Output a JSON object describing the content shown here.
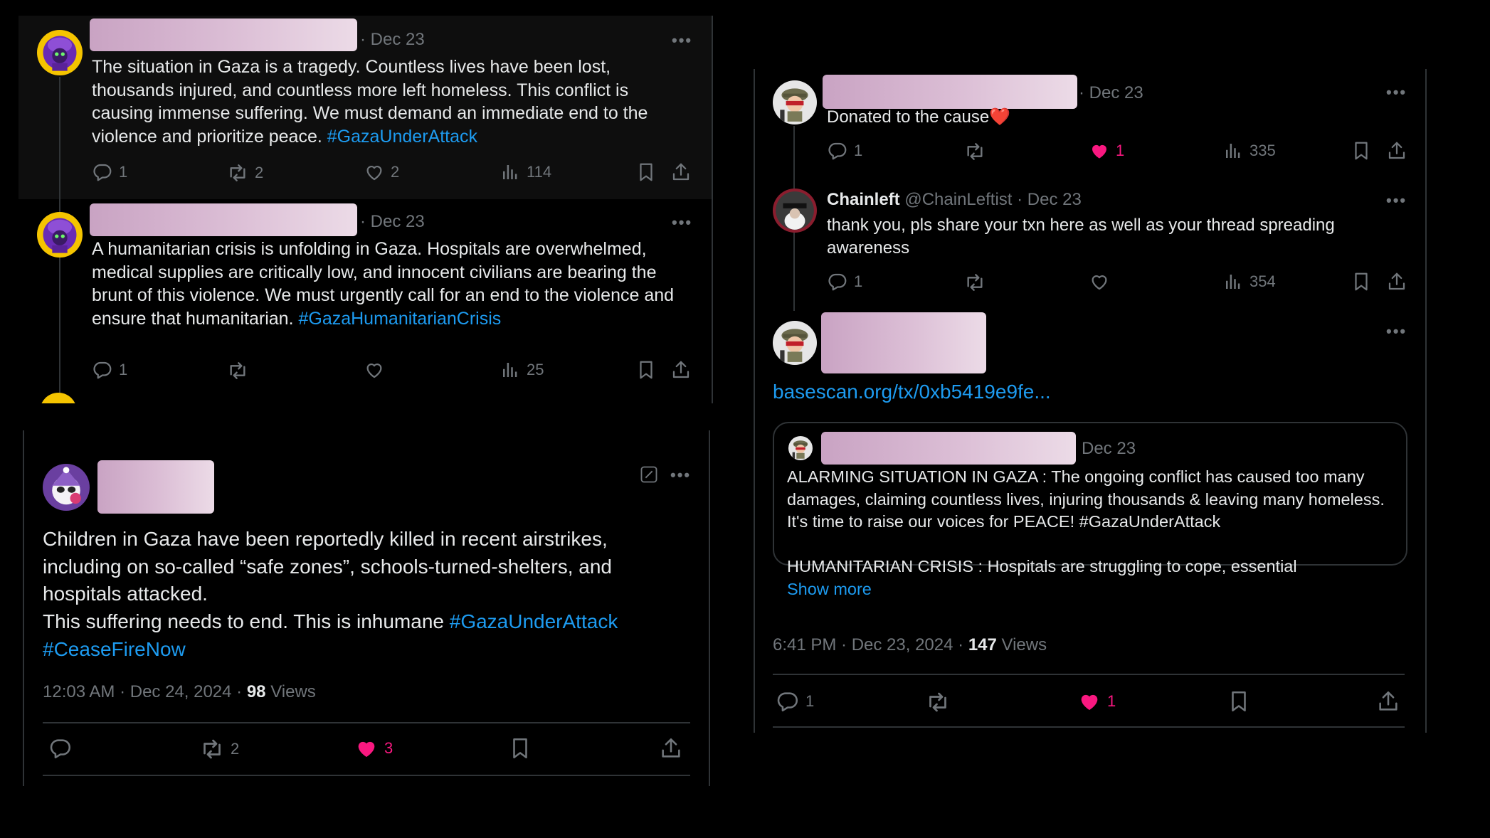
{
  "colors": {
    "background": "#000000",
    "text": "#e7e9ea",
    "muted": "#71767b",
    "link": "#1d9bf0",
    "like": "#f91880",
    "divider": "#2f3336"
  },
  "thread_left": {
    "tweets": [
      {
        "date": "· Dec 23",
        "text": "The situation in Gaza is a tragedy. Countless lives have been lost, thousands injured, and countless more left homeless. This conflict is causing immense suffering. We must demand an immediate end to the violence and prioritize peace.",
        "hashtag": "#GazaUnderAttack",
        "replies": "1",
        "retweets": "2",
        "likes": "2",
        "views": "114"
      },
      {
        "date": "· Dec 23",
        "text": "A humanitarian crisis is unfolding in Gaza. Hospitals are overwhelmed, medical supplies are critically low, and innocent civilians are bearing the brunt of this violence. We must urgently call for an end to the violence and ensure that humanitarian.",
        "hashtag": "#GazaHumanitarianCrisis",
        "replies": "1",
        "retweets": "",
        "likes": "",
        "views": "25"
      }
    ]
  },
  "tweet_bottom": {
    "text_line1": "Children in Gaza have been reportedly killed in recent airstrikes, including on so-called “safe zones”, schools-turned-shelters, and hospitals attacked.",
    "text_line2": "This suffering needs to end. This is inhumane",
    "hashtag1": "#GazaUnderAttack",
    "hashtag2": "#CeaseFireNow",
    "timestamp": "12:03 AM · Dec 24, 2024 · ",
    "views_count": "98",
    "views_label": " Views",
    "replies": "",
    "retweets": "2",
    "likes": "3"
  },
  "thread_right": {
    "tweet1": {
      "date": "· Dec 23",
      "text": "Donated to the cause",
      "heart_emoji": "❤️",
      "replies": "1",
      "retweets": "",
      "likes": "1",
      "views": "335"
    },
    "tweet2": {
      "name": "Chainleft",
      "handle": "@ChainLeftist · Dec 23",
      "text": "thank you, pls share your txn here as well as your thread spreading awareness",
      "replies": "1",
      "retweets": "",
      "likes": "",
      "views": "354"
    },
    "tweet3": {
      "link": "basescan.org/tx/0xb5419e9fe...",
      "quote": {
        "date": "Dec 23",
        "text1": "ALARMING SITUATION IN GAZA : The ongoing conflict has caused too many damages, claiming countless lives, injuring thousands & leaving many homeless. It's time to raise our voices for PEACE! #GazaUnderAttack",
        "text2": "HUMANITARIAN CRISIS : Hospitals are struggling to cope, essential",
        "show_more": "Show more"
      },
      "timestamp": "6:41 PM · Dec 23, 2024 · ",
      "views_count": "147",
      "views_label": " Views",
      "replies": "1",
      "retweets": "",
      "likes": "1"
    }
  }
}
